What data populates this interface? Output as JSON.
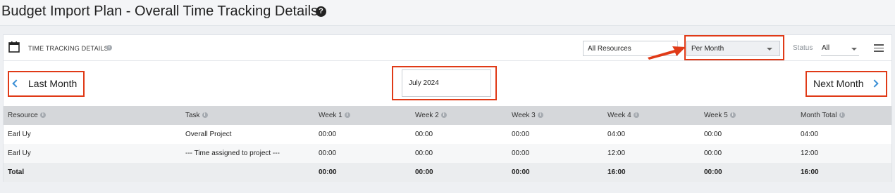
{
  "page": {
    "title": "Budget Import Plan - Overall Time Tracking Details",
    "help_icon": "question-circle-icon"
  },
  "toolbar": {
    "title": "TIME TRACKING DETAILS",
    "resource_filter": "All Resources",
    "period_filter": "Per Month",
    "status_label": "Status",
    "status_value": "All"
  },
  "nav": {
    "prev_label": "Last Month",
    "next_label": "Next Month",
    "current_period": "July 2024"
  },
  "table": {
    "headers": [
      "Resource",
      "Task",
      "Week 1",
      "Week 2",
      "Week 3",
      "Week 4",
      "Week 5",
      "Month Total"
    ],
    "rows": [
      [
        "Earl Uy",
        "Overall Project",
        "00:00",
        "00:00",
        "00:00",
        "04:00",
        "00:00",
        "04:00"
      ],
      [
        "Earl Uy",
        "--- Time assigned to project ---",
        "00:00",
        "00:00",
        "00:00",
        "12:00",
        "00:00",
        "12:00"
      ]
    ],
    "total": [
      "Total",
      "",
      "00:00",
      "00:00",
      "00:00",
      "16:00",
      "00:00",
      "16:00"
    ]
  },
  "colors": {
    "highlight": "#e03a17",
    "accent": "#3a8fd6",
    "header_bg": "#d5d7da"
  }
}
